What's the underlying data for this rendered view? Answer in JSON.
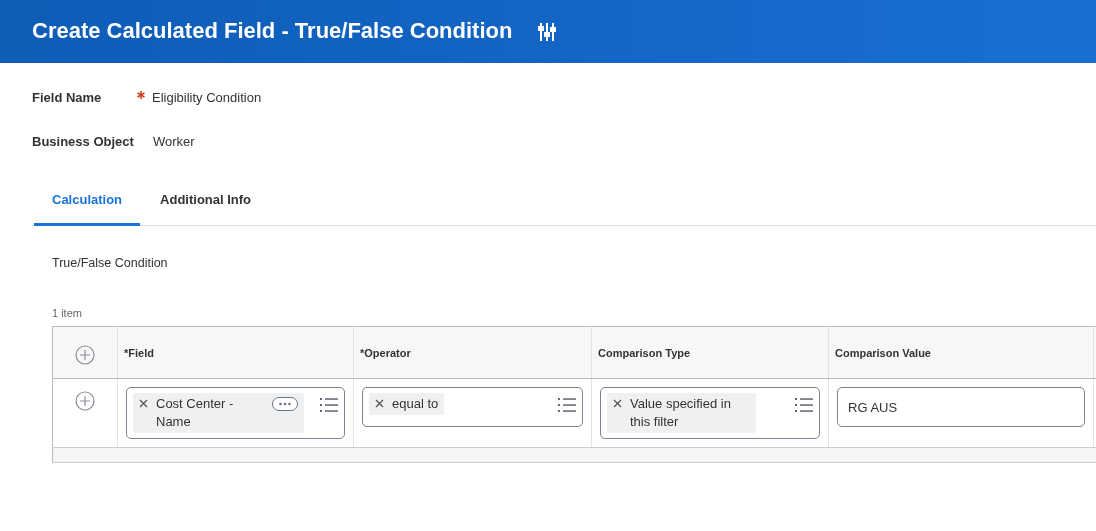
{
  "header": {
    "title": "Create Calculated Field - True/False Condition"
  },
  "fields": [
    {
      "label": "Field Name",
      "required": true,
      "value": "Eligibility Condition"
    },
    {
      "label": "Business Object",
      "required": false,
      "value": "Worker"
    }
  ],
  "tabs": [
    {
      "label": "Calculation",
      "selected": true
    },
    {
      "label": "Additional Info",
      "selected": false
    }
  ],
  "section_title": "True/False Condition",
  "grid": {
    "count": "1 item",
    "columns": [
      "*Field",
      "*Operator",
      "Comparison Type",
      "Comparison Value"
    ],
    "rows": [
      {
        "cells": [
          {
            "kind": "prompt",
            "value": "Cost Center - Name",
            "related_actions": true
          },
          {
            "kind": "prompt",
            "value": "equal to",
            "related_actions": false
          },
          {
            "kind": "prompt",
            "value": "Value specified in this filter",
            "related_actions": false
          },
          {
            "kind": "text",
            "value": "RG AUS"
          }
        ]
      }
    ]
  }
}
